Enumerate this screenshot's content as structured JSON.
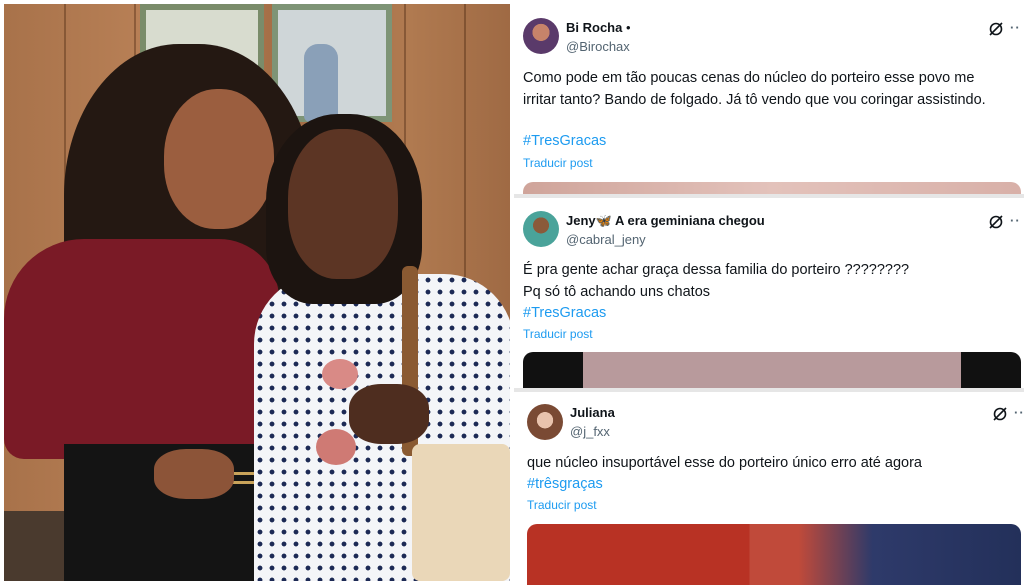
{
  "photo": {
    "description_icon": "photo-icon"
  },
  "tweets": [
    {
      "name": "Bi Rocha",
      "dot": "•",
      "handle": "@Birochax",
      "text_line1": "Como pode em tão poucas cenas do núcleo do porteiro esse povo me",
      "text_line2": "irritar tanto? Bando de folgado. Já tô vendo que vou coringar assistindo.",
      "hashtag": "#TresGracas",
      "translate": "Traducir post"
    },
    {
      "name": "Jeny🦋 A era geminiana chegou",
      "handle": "@cabral_jeny",
      "text_line1": "É pra gente achar graça dessa familia do porteiro ????????",
      "text_line2": "Pq só tô achando uns chatos",
      "hashtag": "#TresGracas",
      "translate": "Traducir post"
    },
    {
      "name": "Juliana",
      "handle": "@j_fxx",
      "text_line1": "que núcleo insuportável esse do porteiro único erro até agora",
      "hashtag": "#trêsgraças",
      "translate": "Traducir post"
    }
  ],
  "icons": {
    "grok": "grok-icon",
    "more": "more-icon"
  },
  "more_glyph": "··",
  "colors": {
    "link": "#1d9bf0",
    "text": "#0f1419",
    "muted": "#536471"
  }
}
